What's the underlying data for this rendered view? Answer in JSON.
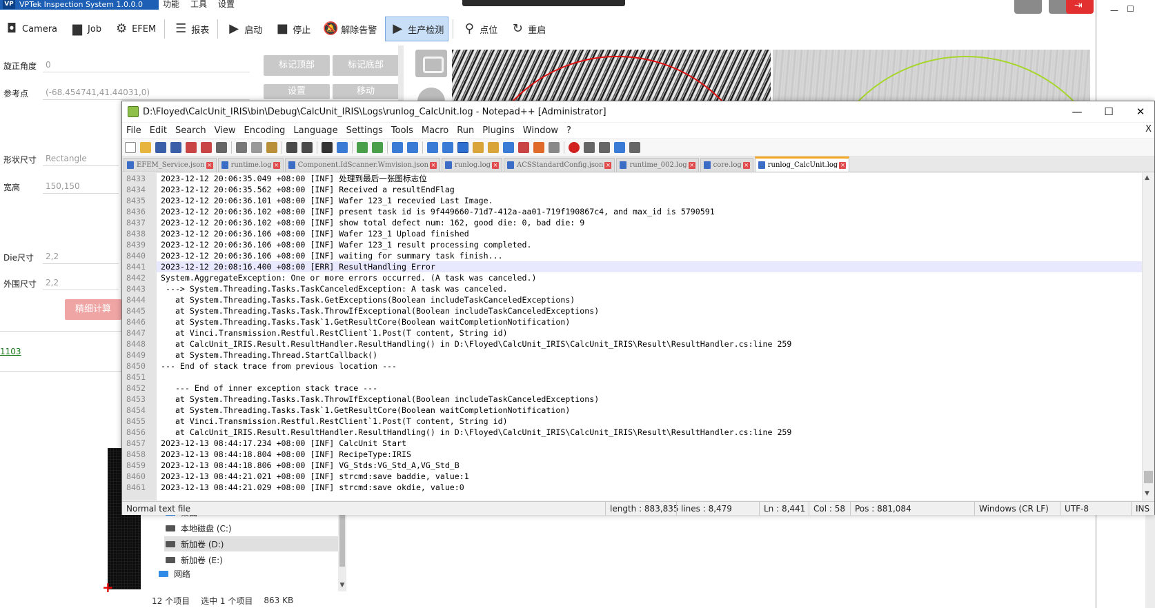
{
  "app": {
    "title": "VPTek Inspection System 1.0.0.0",
    "menu": [
      "功能",
      "工具",
      "设置"
    ],
    "toolbar": [
      {
        "label": "Camera",
        "icon": "camera-icon"
      },
      {
        "label": "Job",
        "icon": "briefcase-icon"
      },
      {
        "label": "EFEM",
        "icon": "robot-arm-icon"
      },
      {
        "label": "报表",
        "icon": "report-icon"
      },
      {
        "label": "启动",
        "icon": "play-icon"
      },
      {
        "label": "停止",
        "icon": "stop-icon"
      },
      {
        "label": "解除告警",
        "icon": "bell-off-icon"
      },
      {
        "label": "生产检测",
        "icon": "play-icon",
        "active": true
      },
      {
        "label": "点位",
        "icon": "location-pin-icon"
      },
      {
        "label": "重启",
        "icon": "restart-icon"
      }
    ],
    "fields": {
      "rotation_label": "旋正角度",
      "rotation_value": "0",
      "ref_label": "参考点",
      "ref_value": "(-68.454741,41.44031,0)",
      "shape_label": "形状尺寸",
      "shape_value": "Rectangle",
      "wh_label": "宽高",
      "wh_value": "150,150",
      "die_label": "Die尺寸",
      "die_value": "2,2",
      "outer_label": "外围尺寸",
      "outer_value": "2,2"
    },
    "buttons": {
      "mark_top": "标记顶部",
      "mark_bottom": "标记底部",
      "set": "设置",
      "move": "移动",
      "fine_calc": "精细计算"
    },
    "link_1103": "1103"
  },
  "explorer": {
    "items": [
      {
        "label": "桌面",
        "icon": "desktop-icon"
      },
      {
        "label": "本地磁盘 (C:)",
        "icon": "drive-icon"
      },
      {
        "label": "新加卷 (D:)",
        "icon": "drive-icon",
        "selected": true
      },
      {
        "label": "新加卷 (E:)",
        "icon": "drive-icon"
      },
      {
        "label": "网络",
        "icon": "network-icon"
      }
    ],
    "status": {
      "count": "12 个项目",
      "selected": "选中 1 个项目",
      "size": "863 KB"
    }
  },
  "npp": {
    "title": "D:\\Floyed\\CalcUnit_IRIS\\bin\\Debug\\CalcUnit_IRIS\\Logs\\runlog_CalcUnit.log - Notepad++ [Administrator]",
    "menu": [
      "File",
      "Edit",
      "Search",
      "View",
      "Encoding",
      "Language",
      "Settings",
      "Tools",
      "Macro",
      "Run",
      "Plugins",
      "Window",
      "?"
    ],
    "menu_close": "X",
    "tabs": [
      {
        "label": "EFEM_Service.json"
      },
      {
        "label": "runtime.log"
      },
      {
        "label": "Component.IdScanner.Wmvision.json"
      },
      {
        "label": "runlog.log"
      },
      {
        "label": "ACSStandardConfig.json"
      },
      {
        "label": "runtime_002.log"
      },
      {
        "label": "core.log"
      },
      {
        "label": "runlog_CalcUnit.log",
        "active": true
      }
    ],
    "lines": [
      {
        "n": "8433",
        "t": "2023-12-12 20:06:35.049 +08:00 [INF] 处理到最后一张图标志位"
      },
      {
        "n": "8434",
        "t": "2023-12-12 20:06:35.562 +08:00 [INF] Received a resultEndFlag"
      },
      {
        "n": "8435",
        "t": "2023-12-12 20:06:36.101 +08:00 [INF] Wafer 123_1 recevied Last Image."
      },
      {
        "n": "8436",
        "t": "2023-12-12 20:06:36.102 +08:00 [INF] present task id is 9f449660-71d7-412a-aa01-719f190867c4, and max_id is 5790591"
      },
      {
        "n": "8437",
        "t": "2023-12-12 20:06:36.102 +08:00 [INF] show total defect num: 162, good die: 0, bad die: 9"
      },
      {
        "n": "8438",
        "t": "2023-12-12 20:06:36.106 +08:00 [INF] Wafer 123_1 Upload finished"
      },
      {
        "n": "8439",
        "t": "2023-12-12 20:06:36.106 +08:00 [INF] Wafer 123_1 result processing completed."
      },
      {
        "n": "8440",
        "t": "2023-12-12 20:06:36.106 +08:00 [INF] waiting for summary task finish..."
      },
      {
        "n": "8441",
        "t": "2023-12-12 20:08:16.400 +08:00 [ERR] ResultHandling Error",
        "current": true
      },
      {
        "n": "8442",
        "t": "System.AggregateException: One or more errors occurred. (A task was canceled.)"
      },
      {
        "n": "8443",
        "t": " ---> System.Threading.Tasks.TaskCanceledException: A task was canceled."
      },
      {
        "n": "8444",
        "t": "   at System.Threading.Tasks.Task.GetExceptions(Boolean includeTaskCanceledExceptions)"
      },
      {
        "n": "8445",
        "t": "   at System.Threading.Tasks.Task.ThrowIfExceptional(Boolean includeTaskCanceledExceptions)"
      },
      {
        "n": "8446",
        "t": "   at System.Threading.Tasks.Task`1.GetResultCore(Boolean waitCompletionNotification)"
      },
      {
        "n": "8447",
        "t": "   at Vinci.Transmission.Restful.RestClient`1.Post(T content, String id)"
      },
      {
        "n": "8448",
        "t": "   at CalcUnit_IRIS.Result.ResultHandler.ResultHandling() in D:\\Floyed\\CalcUnit_IRIS\\CalcUnit_IRIS\\Result\\ResultHandler.cs:line 259"
      },
      {
        "n": "8449",
        "t": "   at System.Threading.Thread.StartCallback()"
      },
      {
        "n": "8450",
        "t": "--- End of stack trace from previous location ---"
      },
      {
        "n": "8451",
        "t": ""
      },
      {
        "n": "8452",
        "t": "   --- End of inner exception stack trace ---"
      },
      {
        "n": "8453",
        "t": "   at System.Threading.Tasks.Task.ThrowIfExceptional(Boolean includeTaskCanceledExceptions)"
      },
      {
        "n": "8454",
        "t": "   at System.Threading.Tasks.Task`1.GetResultCore(Boolean waitCompletionNotification)"
      },
      {
        "n": "8455",
        "t": "   at Vinci.Transmission.Restful.RestClient`1.Post(T content, String id)"
      },
      {
        "n": "8456",
        "t": "   at CalcUnit_IRIS.Result.ResultHandler.ResultHandling() in D:\\Floyed\\CalcUnit_IRIS\\CalcUnit_IRIS\\Result\\ResultHandler.cs:line 259"
      },
      {
        "n": "8457",
        "t": "2023-12-13 08:44:17.234 +08:00 [INF] CalcUnit Start"
      },
      {
        "n": "8458",
        "t": "2023-12-13 08:44:18.804 +08:00 [INF] RecipeType:IRIS"
      },
      {
        "n": "8459",
        "t": "2023-12-13 08:44:18.806 +08:00 [INF] VG_Stds:VG_Std_A,VG_Std_B"
      },
      {
        "n": "8460",
        "t": "2023-12-13 08:44:21.021 +08:00 [INF] strcmd:save baddie, value:1"
      },
      {
        "n": "8461",
        "t": "2023-12-13 08:44:21.029 +08:00 [INF] strcmd:save okdie, value:0"
      }
    ],
    "status": {
      "file_type": "Normal text file",
      "length": "length : 883,835",
      "lines": "lines : 8,479",
      "ln": "Ln : 8,441",
      "col": "Col : 58",
      "pos": "Pos : 881,084",
      "eol": "Windows (CR LF)",
      "encoding": "UTF-8",
      "mode": "INS"
    },
    "colors": {
      "current_line": "#e8e8ff",
      "tab_active_accent": "#f5a623"
    }
  }
}
